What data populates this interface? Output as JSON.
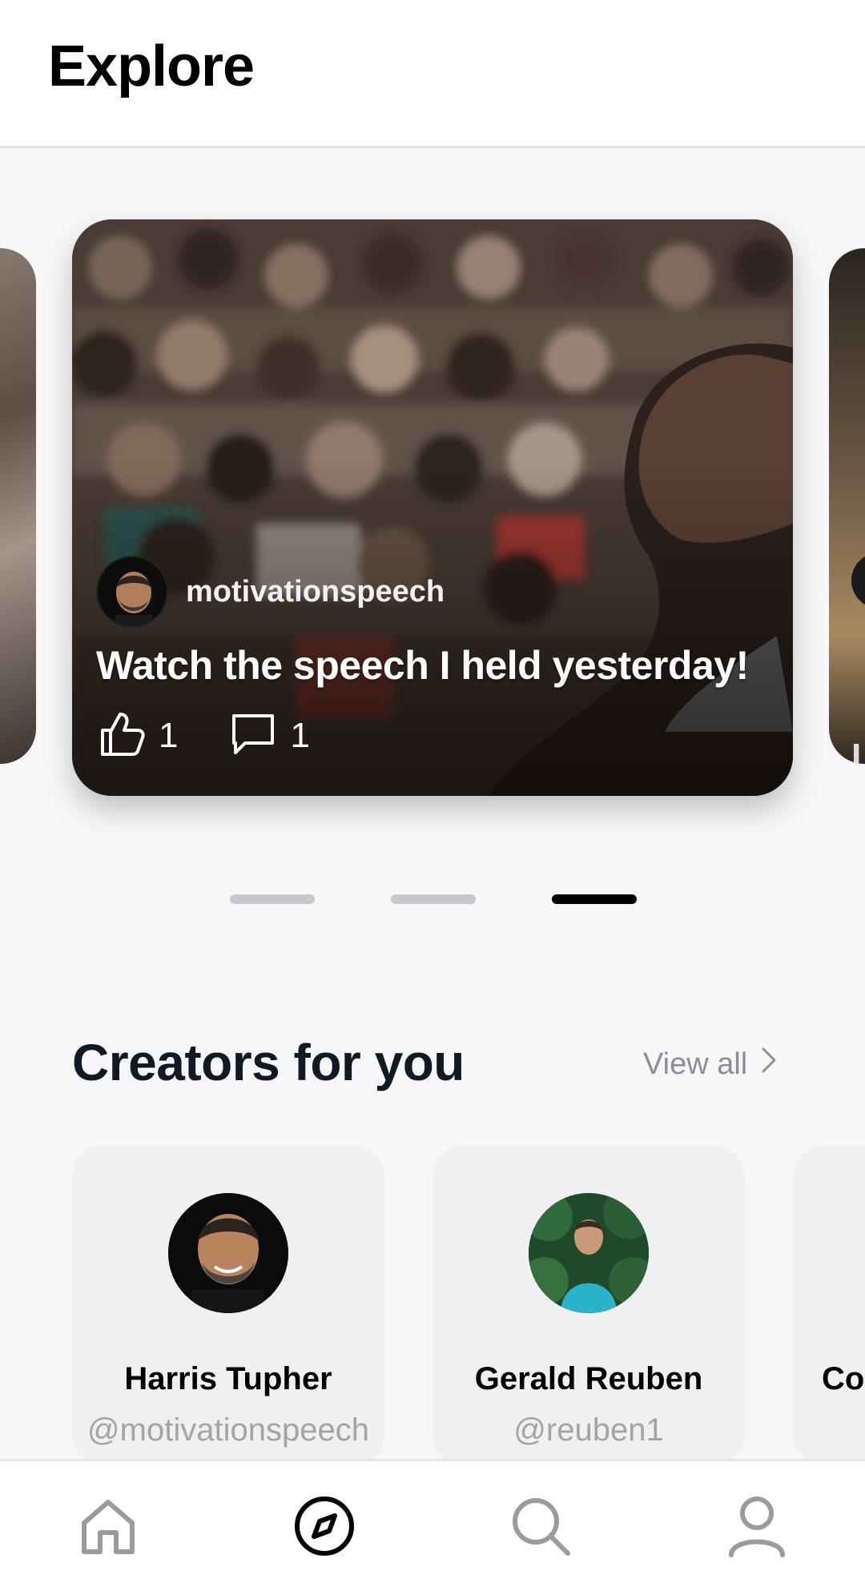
{
  "header": {
    "title": "Explore"
  },
  "carousel": {
    "active_index": 2,
    "page_count": 3,
    "card": {
      "username": "motivationspeech",
      "caption": "Watch the speech I held yesterday!",
      "likes": "1",
      "comments": "1"
    },
    "next_card_peek_text": "L"
  },
  "creators": {
    "title": "Creators for you",
    "view_all_label": "View all",
    "items": [
      {
        "name": "Harris Tupher",
        "handle": "@motivationspeech"
      },
      {
        "name": "Gerald Reuben",
        "handle": "@reuben1"
      },
      {
        "name": "Co",
        "handle": ""
      }
    ]
  },
  "nav": {
    "items": [
      {
        "icon": "home-icon",
        "active": false
      },
      {
        "icon": "compass-icon",
        "active": true
      },
      {
        "icon": "search-icon",
        "active": false
      },
      {
        "icon": "profile-icon",
        "active": false
      }
    ]
  },
  "colors": {
    "background": "#f7f7f9",
    "header_bg": "#ffffff",
    "text_primary": "#0b0f14",
    "text_muted": "#8b8f95",
    "dot_active": "#000000",
    "dot_inactive": "#c8c8cc"
  }
}
